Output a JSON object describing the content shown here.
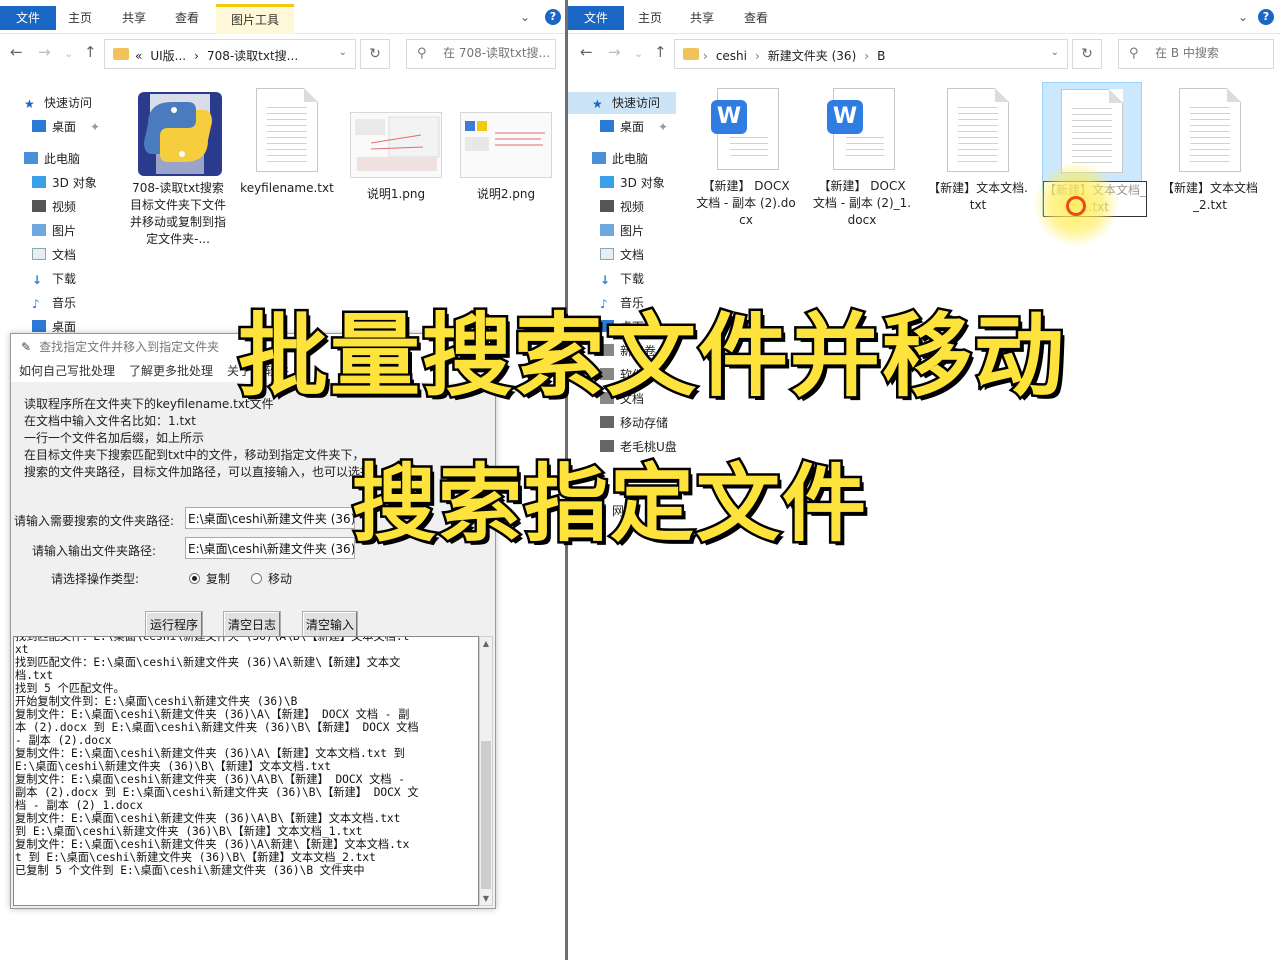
{
  "left_explorer": {
    "ribbon": {
      "file_tab": "文件",
      "tabs": [
        "主页",
        "共享",
        "查看"
      ],
      "context_tab": "图片工具"
    },
    "address": {
      "crumbs": [
        "«",
        "UI版...",
        "›",
        "708-读取txt搜...",
        ""
      ]
    },
    "search_placeholder": "在 708-读取txt搜...",
    "nav": [
      "快速访问",
      "桌面",
      "此电脑",
      "3D 对象",
      "视频",
      "图片",
      "文档",
      "下载",
      "音乐",
      "桌面"
    ],
    "files": [
      {
        "name": "708-读取txt搜索目标文件夹下文件并移动或复制到指定文件夹-...",
        "icon": "python-icon"
      },
      {
        "name": "keyfilename.txt",
        "icon": "text-file-icon"
      },
      {
        "name": "说明1.png",
        "icon": "image-thumbnail"
      },
      {
        "name": "说明2.png",
        "icon": "image-thumbnail"
      }
    ]
  },
  "right_explorer": {
    "ribbon": {
      "file_tab": "文件",
      "tabs": [
        "主页",
        "共享",
        "查看"
      ]
    },
    "address": {
      "crumbs": [
        "ceshi",
        "›",
        "新建文件夹 (36)",
        "›",
        "B"
      ]
    },
    "search_placeholder": "在 B 中搜索",
    "nav": [
      "快速访问",
      "桌面",
      "此电脑",
      "3D 对象",
      "视频",
      "图片",
      "文档",
      "下载",
      "音乐",
      "桌面",
      "新加卷",
      "软件",
      "文档",
      "移动存储",
      "老毛桃U盘",
      "网络"
    ],
    "files": [
      {
        "name": "【新建】 DOCX 文档 - 副本 (2).docx",
        "icon": "word-icon"
      },
      {
        "name": "【新建】 DOCX 文档 - 副本 (2)_1.docx",
        "icon": "word-icon"
      },
      {
        "name": "【新建】文本文档.txt",
        "icon": "text-file-icon"
      },
      {
        "name": "【新建】文本文档_1.txt",
        "icon": "text-file-icon"
      },
      {
        "name": "【新建】文本文档_2.txt",
        "icon": "text-file-icon"
      }
    ]
  },
  "tool": {
    "title": "查找指定文件并移入到指定文件夹",
    "menu": [
      "如何自己写批处理",
      "了解更多批处理",
      "关于",
      "软件"
    ],
    "description": [
      "读取程序所在文件夹下的keyfilename.txt文件",
      "在文档中输入文件名比如：1.txt",
      "一行一个文件名加后缀，如上所示",
      "在目标文件夹下搜索匹配到txt中的文件，移动到指定文件夹下，",
      "搜索的文件夹路径，目标文件加路径，可以直接输入，也可以选择"
    ],
    "search_label": "请输入需要搜索的文件夹路径:",
    "search_value": "E:\\桌面\\ceshi\\新建文件夹 (36)",
    "output_label": "请输入输出文件夹路径:",
    "output_value": "E:\\桌面\\ceshi\\新建文件夹 (36)",
    "op_label": "请选择操作类型:",
    "op_copy": "复制",
    "op_move": "移动",
    "op_selected": "复制",
    "buttons": {
      "run": "运行程序",
      "clear_log": "清空日志",
      "clear_input": "清空输入"
    },
    "log": "找到匹配文件：E:\\桌面\\ceshi\\新建文件夹 (36)\\A\\B\\【新建】文本文档.t\nxt\n找到匹配文件：E:\\桌面\\ceshi\\新建文件夹 (36)\\A\\新建\\【新建】文本文\n档.txt\n找到 5 个匹配文件。\n开始复制文件到：E:\\桌面\\ceshi\\新建文件夹 (36)\\B\n复制文件：E:\\桌面\\ceshi\\新建文件夹 (36)\\A\\【新建】 DOCX 文档 - 副\n本 (2).docx 到 E:\\桌面\\ceshi\\新建文件夹 (36)\\B\\【新建】 DOCX 文档\n- 副本 (2).docx\n复制文件：E:\\桌面\\ceshi\\新建文件夹 (36)\\A\\【新建】文本文档.txt 到\nE:\\桌面\\ceshi\\新建文件夹 (36)\\B\\【新建】文本文档.txt\n复制文件：E:\\桌面\\ceshi\\新建文件夹 (36)\\A\\B\\【新建】 DOCX 文档 -\n副本 (2).docx 到 E:\\桌面\\ceshi\\新建文件夹 (36)\\B\\【新建】 DOCX 文\n档 - 副本 (2)_1.docx\n复制文件：E:\\桌面\\ceshi\\新建文件夹 (36)\\A\\B\\【新建】文本文档.txt\n到 E:\\桌面\\ceshi\\新建文件夹 (36)\\B\\【新建】文本文档_1.txt\n复制文件：E:\\桌面\\ceshi\\新建文件夹 (36)\\A\\新建\\【新建】文本文档.tx\nt 到 E:\\桌面\\ceshi\\新建文件夹 (36)\\B\\【新建】文本文档_2.txt\n已复制 5 个文件到 E:\\桌面\\ceshi\\新建文件夹 (36)\\B 文件夹中"
  },
  "overlay": {
    "caption1": "批量搜索文件并移动",
    "caption2": "搜索指定文件"
  },
  "colors": {
    "accent": "#1a66c4",
    "caption_fill": "#ffe33d",
    "selection": "#cce8ff"
  }
}
